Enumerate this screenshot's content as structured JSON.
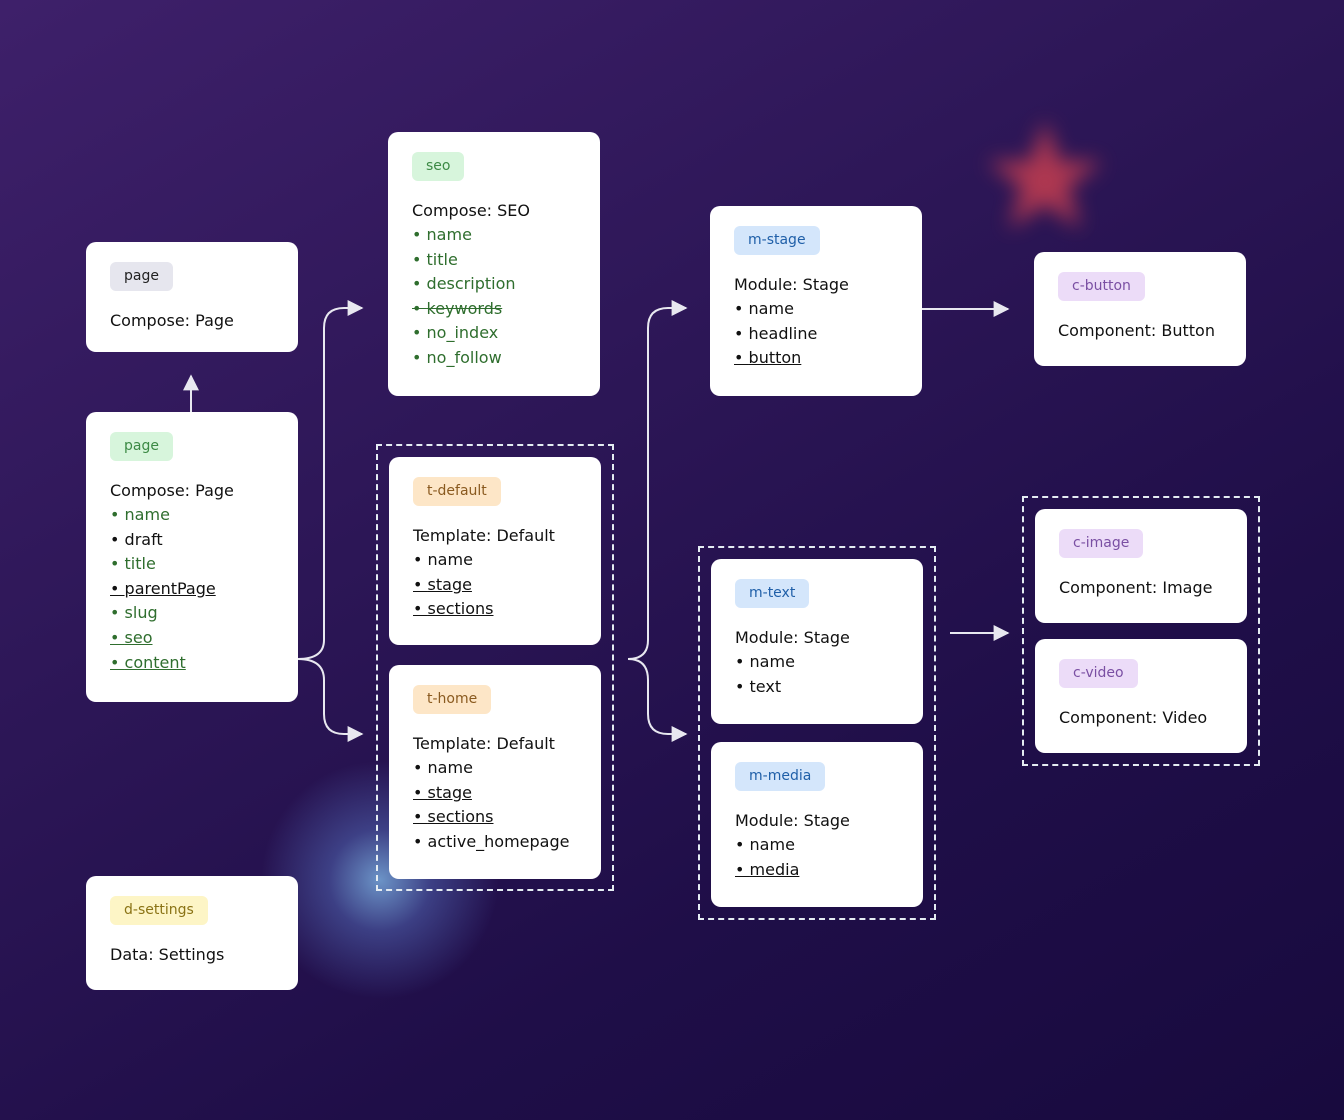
{
  "cards": {
    "page_top": {
      "tag": "page",
      "title": "Compose: Page"
    },
    "page_main": {
      "tag": "page",
      "title": "Compose: Page",
      "fields": [
        {
          "label": "name",
          "style": "green"
        },
        {
          "label": "draft",
          "style": "plain"
        },
        {
          "label": "title",
          "style": "green"
        },
        {
          "label": "parentPage",
          "style": "underline"
        },
        {
          "label": "slug",
          "style": "green"
        },
        {
          "label": "seo",
          "style": "green-underline"
        },
        {
          "label": "content",
          "style": "green-underline"
        }
      ]
    },
    "d_settings": {
      "tag": "d-settings",
      "title": "Data: Settings"
    },
    "seo": {
      "tag": "seo",
      "title": "Compose: SEO",
      "fields": [
        {
          "label": "name",
          "style": "green"
        },
        {
          "label": "title",
          "style": "green"
        },
        {
          "label": "description",
          "style": "green"
        },
        {
          "label": "keywords",
          "style": "green-strike"
        },
        {
          "label": "no_index",
          "style": "green"
        },
        {
          "label": "no_follow",
          "style": "green"
        }
      ]
    },
    "t_default": {
      "tag": "t-default",
      "title": "Template: Default",
      "fields": [
        {
          "label": "name",
          "style": "plain"
        },
        {
          "label": "stage",
          "style": "underline"
        },
        {
          "label": "sections",
          "style": "underline"
        }
      ]
    },
    "t_home": {
      "tag": "t-home",
      "title": "Template: Default",
      "fields": [
        {
          "label": "name",
          "style": "plain"
        },
        {
          "label": "stage",
          "style": "underline"
        },
        {
          "label": "sections",
          "style": "underline"
        },
        {
          "label": "active_homepage",
          "style": "plain"
        }
      ]
    },
    "m_stage": {
      "tag": "m-stage",
      "title": "Module: Stage",
      "fields": [
        {
          "label": "name",
          "style": "plain"
        },
        {
          "label": "headline",
          "style": "plain"
        },
        {
          "label": "button",
          "style": "underline"
        }
      ]
    },
    "m_text": {
      "tag": "m-text",
      "title": "Module: Stage",
      "fields": [
        {
          "label": "name",
          "style": "plain"
        },
        {
          "label": "text",
          "style": "plain"
        }
      ]
    },
    "m_media": {
      "tag": "m-media",
      "title": "Module: Stage",
      "fields": [
        {
          "label": "name",
          "style": "plain"
        },
        {
          "label": "media",
          "style": "underline"
        }
      ]
    },
    "c_button": {
      "tag": "c-button",
      "title": "Component: Button"
    },
    "c_image": {
      "tag": "c-image",
      "title": "Component: Image"
    },
    "c_video": {
      "tag": "c-video",
      "title": "Component: Video"
    }
  },
  "colors": {
    "background_top": "#3e206a",
    "background_bottom": "#180a3e",
    "connector": "#e8e8f0",
    "field_green": "#2f6e2e",
    "glow_star": "#d9434f",
    "glow_blue": "#78aadc"
  }
}
